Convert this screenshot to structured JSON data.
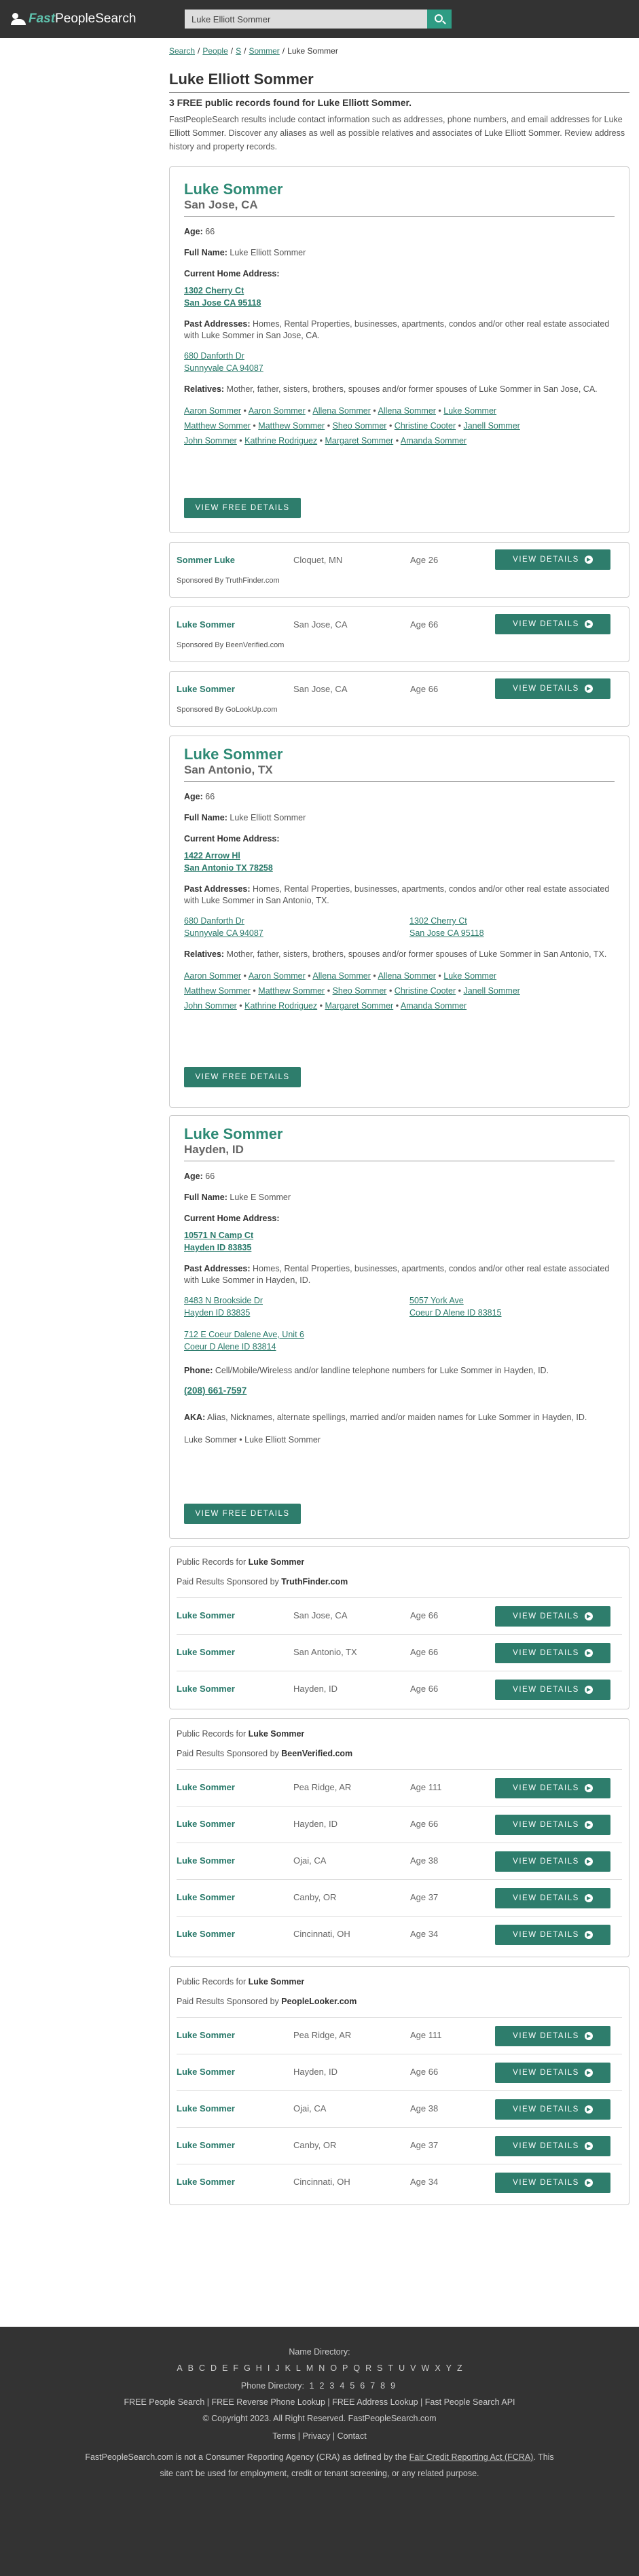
{
  "header": {
    "logo_fast": "Fast",
    "logo_rest": "PeopleSearch",
    "search_value": "Luke Elliott Sommer"
  },
  "breadcrumbs": [
    "Search",
    "People",
    "S",
    "Sommer",
    "Luke Sommer"
  ],
  "title": "Luke Elliott Sommer",
  "count_text": "3 FREE public records found for Luke Elliott Sommer.",
  "intro": "FastPeopleSearch results include contact information such as addresses, phone numbers, and email addresses for Luke Elliott Sommer. Discover any aliases as well as possible relatives and associates of Luke Elliott Sommer. Review address history and property records.",
  "labels": {
    "age": "Age:",
    "full_name": "Full Name:",
    "current_address": "Current Home Address:",
    "past_addresses": "Past Addresses:",
    "relatives": "Relatives:",
    "phone": "Phone:",
    "aka": "AKA:",
    "view_free_details": "VIEW FREE DETAILS",
    "view_details": "VIEW DETAILS",
    "public_records_for": "Public Records for",
    "paid_results": "Paid Results Sponsored by"
  },
  "persons": [
    {
      "name": "Luke Sommer",
      "location": "San Jose, CA",
      "age": "66",
      "full_name": "Luke Elliott Sommer",
      "current_address": [
        "1302 Cherry Ct",
        "San Jose CA 95118"
      ],
      "past_text": "Homes, Rental Properties, businesses, apartments, condos and/or other real estate associated with Luke Sommer in San Jose, CA.",
      "past_addresses": [
        [
          "680 Danforth Dr",
          "Sunnyvale CA 94087"
        ]
      ],
      "relatives_text": "Mother, father, sisters, brothers, spouses and/or former spouses of Luke Sommer in San Jose, CA.",
      "relatives": [
        [
          "Aaron Sommer",
          "Aaron Sommer",
          "Allena Sommer",
          "Allena Sommer",
          "Luke Sommer"
        ],
        [
          "Matthew Sommer",
          "Matthew Sommer",
          "Sheo Sommer",
          "Christine Cooter",
          "Janell Sommer"
        ],
        [
          "John Sommer",
          "Kathrine Rodriguez",
          "Margaret Sommer",
          "Amanda Sommer"
        ]
      ]
    },
    {
      "name": "Luke Sommer",
      "location": "San Antonio, TX",
      "age": "66",
      "full_name": "Luke Elliott Sommer",
      "current_address": [
        "1422 Arrow Hl",
        "San Antonio TX 78258"
      ],
      "past_text": "Homes, Rental Properties, businesses, apartments, condos and/or other real estate associated with Luke Sommer in San Antonio, TX.",
      "past_addresses": [
        [
          "680 Danforth Dr",
          "Sunnyvale CA 94087"
        ],
        [
          "1302 Cherry Ct",
          "San Jose CA 95118"
        ]
      ],
      "relatives_text": "Mother, father, sisters, brothers, spouses and/or former spouses of Luke Sommer in San Antonio, TX.",
      "relatives": [
        [
          "Aaron Sommer",
          "Aaron Sommer",
          "Allena Sommer",
          "Allena Sommer",
          "Luke Sommer"
        ],
        [
          "Matthew Sommer",
          "Matthew Sommer",
          "Sheo Sommer",
          "Christine Cooter",
          "Janell Sommer"
        ],
        [
          "John Sommer",
          "Kathrine Rodriguez",
          "Margaret Sommer",
          "Amanda Sommer"
        ]
      ]
    },
    {
      "name": "Luke Sommer",
      "location": "Hayden, ID",
      "age": "66",
      "full_name": "Luke E Sommer",
      "current_address": [
        "10571 N Camp Ct",
        "Hayden ID 83835"
      ],
      "past_text": "Homes, Rental Properties, businesses, apartments, condos and/or other real estate associated with Luke Sommer in Hayden, ID.",
      "past_addresses": [
        [
          "8483 N Brookside Dr",
          "Hayden ID 83835"
        ],
        [
          "5057 York Ave",
          "Coeur D Alene ID 83815"
        ],
        [
          "712 E Coeur Dalene Ave, Unit 6",
          "Coeur D Alene ID 83814"
        ]
      ],
      "phone_text": "Cell/Mobile/Wireless and/or landline telephone numbers for Luke Sommer in Hayden, ID.",
      "phone": "(208) 661-7597",
      "aka_text": "Alias, Nicknames, alternate spellings, married and/or maiden names for Luke Sommer in Hayden, ID.",
      "aka": "Luke Sommer • Luke Elliott Sommer"
    }
  ],
  "sponsored_mini": [
    {
      "name": "Sommer Luke",
      "city": "Cloquet, MN",
      "age": "Age 26",
      "sponsor": "Sponsored By TruthFinder.com"
    },
    {
      "name": "Luke Sommer",
      "city": "San Jose, CA",
      "age": "Age 66",
      "sponsor": "Sponsored By BeenVerified.com"
    },
    {
      "name": "Luke Sommer",
      "city": "San Jose, CA",
      "age": "Age 66",
      "sponsor": "Sponsored By GoLookUp.com"
    }
  ],
  "paid_blocks": [
    {
      "name": "Luke Sommer",
      "sponsor": "TruthFinder.com",
      "rows": [
        {
          "name": "Luke Sommer",
          "city": "San Jose, CA",
          "age": "Age 66"
        },
        {
          "name": "Luke Sommer",
          "city": "San Antonio, TX",
          "age": "Age 66"
        },
        {
          "name": "Luke Sommer",
          "city": "Hayden, ID",
          "age": "Age 66"
        }
      ]
    },
    {
      "name": "Luke Sommer",
      "sponsor": "BeenVerified.com",
      "rows": [
        {
          "name": "Luke Sommer",
          "city": "Pea Ridge, AR",
          "age": "Age 111"
        },
        {
          "name": "Luke Sommer",
          "city": "Hayden, ID",
          "age": "Age 66"
        },
        {
          "name": "Luke Sommer",
          "city": "Ojai, CA",
          "age": "Age 38"
        },
        {
          "name": "Luke Sommer",
          "city": "Canby, OR",
          "age": "Age 37"
        },
        {
          "name": "Luke Sommer",
          "city": "Cincinnati, OH",
          "age": "Age 34"
        }
      ]
    },
    {
      "name": "Luke Sommer",
      "sponsor": "PeopleLooker.com",
      "rows": [
        {
          "name": "Luke Sommer",
          "city": "Pea Ridge, AR",
          "age": "Age 111"
        },
        {
          "name": "Luke Sommer",
          "city": "Hayden, ID",
          "age": "Age 66"
        },
        {
          "name": "Luke Sommer",
          "city": "Ojai, CA",
          "age": "Age 38"
        },
        {
          "name": "Luke Sommer",
          "city": "Canby, OR",
          "age": "Age 37"
        },
        {
          "name": "Luke Sommer",
          "city": "Cincinnati, OH",
          "age": "Age 34"
        }
      ]
    }
  ],
  "footer": {
    "name_directory": "Name Directory:",
    "letters": [
      "A",
      "B",
      "C",
      "D",
      "E",
      "F",
      "G",
      "H",
      "I",
      "J",
      "K",
      "L",
      "M",
      "N",
      "O",
      "P",
      "Q",
      "R",
      "S",
      "T",
      "U",
      "V",
      "W",
      "X",
      "Y",
      "Z"
    ],
    "phone_directory": "Phone Directory:",
    "digits": [
      "1",
      "2",
      "3",
      "4",
      "5",
      "6",
      "7",
      "8",
      "9"
    ],
    "links_line": "FREE People Search | FREE Reverse Phone Lookup | FREE Address Lookup | Fast People Search API",
    "copyright": "© Copyright 2023. All Right Reserved. FastPeopleSearch.com",
    "policy_line": "Terms | Privacy | Contact",
    "disclaimer_1": "FastPeopleSearch.com is not a Consumer Reporting Agency (CRA) as defined by the",
    "fcra": "Fair Credit Reporting Act (FCRA)",
    "disclaimer_2": ". This site can't be used for employment, credit or tenant screening, or any related purpose."
  }
}
